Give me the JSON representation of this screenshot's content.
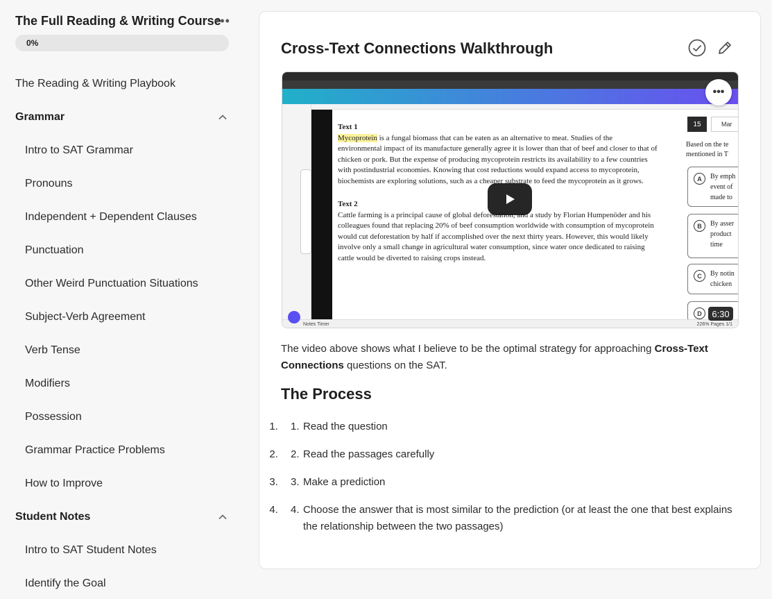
{
  "sidebar": {
    "course_title": "The Full Reading & Writing Course",
    "more_label": "•••",
    "progress": {
      "percent": 0,
      "label": "0%"
    },
    "playbook": "The Reading & Writing Playbook",
    "sections": [
      {
        "title": "Grammar",
        "items": [
          "Intro to SAT Grammar",
          "Pronouns",
          "Independent + Dependent Clauses",
          "Punctuation",
          "Other Weird Punctuation Situations",
          "Subject-Verb Agreement",
          "Verb Tense",
          "Modifiers",
          "Possession",
          "Grammar Practice Problems",
          "How to Improve"
        ]
      },
      {
        "title": "Student Notes",
        "items": [
          "Intro to SAT Student Notes",
          "Identify the Goal"
        ]
      }
    ]
  },
  "lesson": {
    "title": "Cross-Text Connections Walkthrough",
    "video": {
      "duration": "6:30",
      "doc": {
        "text1_label": "Text 1",
        "text1_parts": [
          "Mycoprotein",
          " is a fungal biomass that can be eaten as an alternative to meat. Studies of the environmental impact of its manufacture generally agree it is lower than that of beef and closer to that of chicken or pork. But the expense of producing mycoprotein restricts its availability to a few countries with postindustrial economies. Knowing that cost reductions would expand access to mycoprotein, biochemists are exploring solutions, such as a cheaper substrate to feed the mycoprotein as it grows."
        ],
        "text2_label": "Text 2",
        "text2": "Cattle farming is a principal cause of global deforestation, and a study by Florian Humpenöder and his colleagues found that replacing 20% of beef consumption worldwide with consumption of mycoprotein would cut deforestation by half if accomplished over the next thirty years. However, this would likely involve only a small change in agricultural water consumption, since water once dedicated to raising cattle would be diverted to raising crops instead."
      },
      "question": {
        "number": "15",
        "mark": "Mar",
        "stem_line1": "Based on the te",
        "stem_line2": "mentioned in T",
        "options": [
          {
            "letter": "A",
            "lines": [
              "By emph",
              "event of",
              "made to"
            ]
          },
          {
            "letter": "B",
            "lines": [
              "By asser",
              "product",
              "time"
            ]
          },
          {
            "letter": "C",
            "lines": [
              "By notin",
              "chicken"
            ]
          },
          {
            "letter": "D",
            "lines": [
              ""
            ]
          }
        ]
      },
      "status_left": "Notes   Timer",
      "status_right": "226%   Pages 1/1"
    },
    "intro_before": "The video above shows what I believe to be the optimal strategy for approaching ",
    "intro_bold": "Cross-Text Connections",
    "intro_after": " questions on the SAT.",
    "process_heading": "The Process",
    "steps": [
      "Read the question",
      "Read the passages carefully",
      "Make a prediction",
      "Choose the answer that is most similar to the prediction (or at least the one that best explains the relationship between the two passages)"
    ]
  },
  "colors": {
    "accent": "#3c7bd0",
    "highlight": "#fbf29b",
    "text": "#1f1f1f"
  }
}
